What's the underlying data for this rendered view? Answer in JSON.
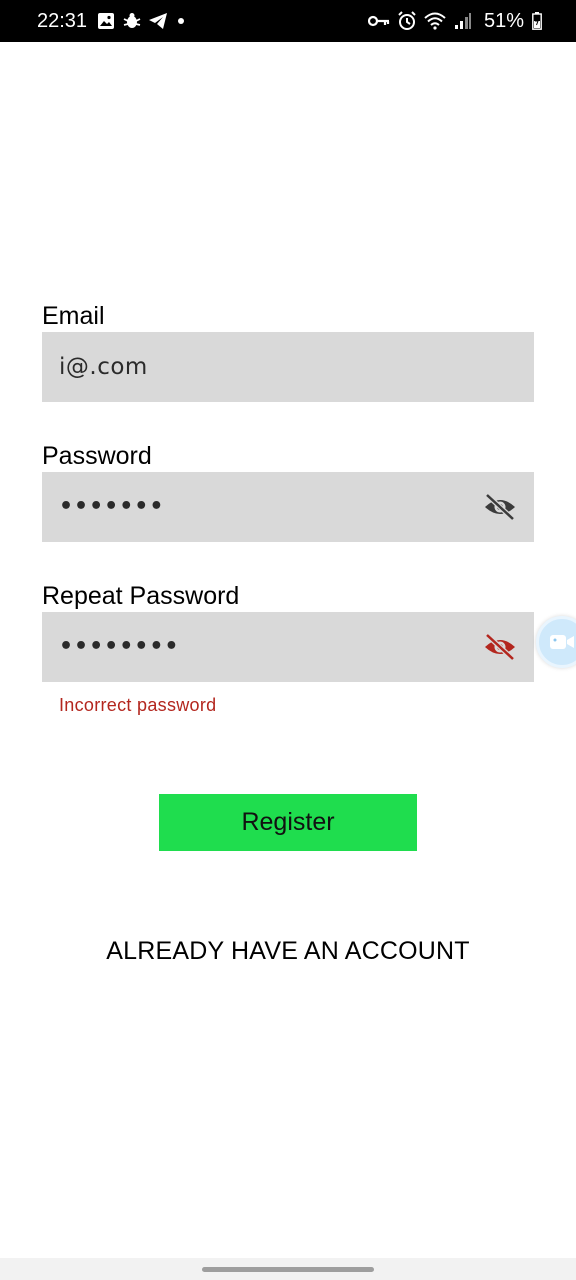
{
  "status_bar": {
    "time": "22:31",
    "left_icons": [
      "gallery-icon",
      "bug-icon",
      "telegram-icon",
      "dot"
    ],
    "right_icons": [
      "key-icon",
      "alarm-icon",
      "wifi-icon",
      "signal-icon"
    ],
    "battery_percent": "51%"
  },
  "form": {
    "email": {
      "label": "Email",
      "value": "i@.com"
    },
    "password": {
      "label": "Password",
      "masked_value": "•••••••",
      "toggle_icon": "eye-off-icon",
      "toggle_color": "#3b3b3b"
    },
    "repeat_password": {
      "label": "Repeat Password",
      "masked_value": "••••••••",
      "toggle_icon": "eye-off-icon",
      "toggle_color": "#b3261e",
      "error": "Incorrect password"
    }
  },
  "actions": {
    "register_label": "Register",
    "login_link_label": "ALREADY HAVE AN ACCOUNT"
  },
  "floating_bubble": {
    "icon": "video-camera-icon"
  },
  "colors": {
    "field_background": "#d9d9d9",
    "register_button": "#1fdd4e",
    "error": "#b3261e",
    "status_bar": "#000000"
  }
}
